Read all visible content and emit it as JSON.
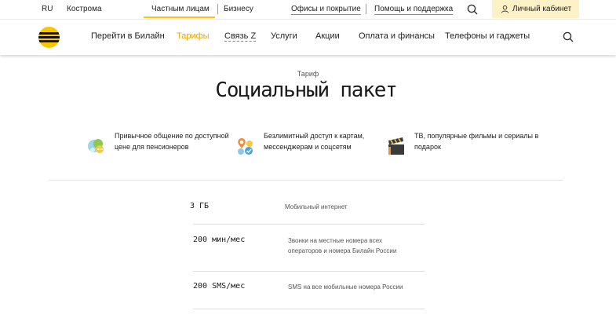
{
  "topbar": {
    "lang": "RU",
    "city": "Кострома",
    "private": "Частным лицам",
    "business": "Бизнесу",
    "offices": "Офисы и покрытие",
    "help": "Помощь и поддержка",
    "cabinet": "Личный кабинет",
    "accent_color": "#f9c80a"
  },
  "nav": {
    "items": [
      {
        "label": "Перейти в Билайн"
      },
      {
        "label": "Тарифы"
      },
      {
        "label": "Связь Z"
      },
      {
        "label": "Услуги"
      },
      {
        "label": "Акции"
      },
      {
        "label": "Оплата и финансы"
      },
      {
        "label": "Телефоны и гаджеты"
      }
    ],
    "active_color": "#e8a50c"
  },
  "page": {
    "eyebrow": "Тариф",
    "title": "Социальный пакет"
  },
  "features": [
    {
      "icon": "chat-bubbles-icon",
      "text": "Привычное общение по доступной цене для пенсионеров"
    },
    {
      "icon": "map-pin-apps-icon",
      "text": "Безлимитный доступ к картам, мессенджерам и соцсетям"
    },
    {
      "icon": "clapperboard-icon",
      "text": "ТВ, популярные фильмы и сериалы в подарок"
    }
  ],
  "params": [
    {
      "value": "3 ГБ",
      "desc": "Мобильный интернет"
    },
    {
      "value": "200 мин/мес",
      "desc": "Звонки на местные номера всех операторов и номера Билайн России"
    },
    {
      "value": "200 SMS/мес",
      "desc": "SMS на все мобильные номера России"
    }
  ]
}
